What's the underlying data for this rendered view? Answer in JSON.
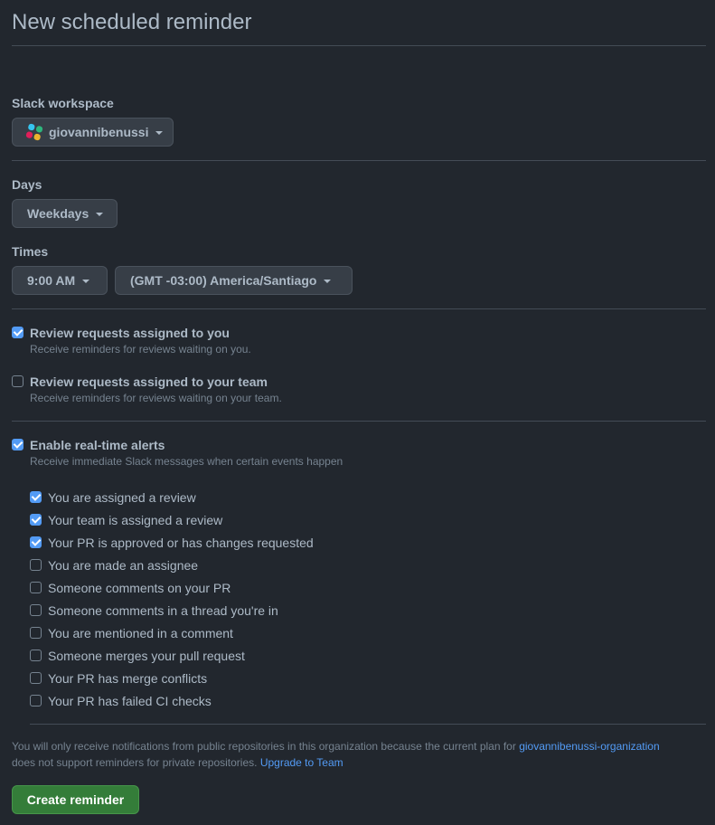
{
  "page": {
    "title": "New scheduled reminder"
  },
  "workspace": {
    "label": "Slack workspace",
    "value": "giovannibenussi",
    "icon": "slack-icon"
  },
  "days": {
    "label": "Days",
    "value": "Weekdays"
  },
  "times": {
    "label": "Times",
    "time_value": "9:00 AM",
    "timezone_value": "(GMT -03:00) America/Santiago"
  },
  "review_options": [
    {
      "title": "Review requests assigned to you",
      "description": "Receive reminders for reviews waiting on you.",
      "checked": true
    },
    {
      "title": "Review requests assigned to your team",
      "description": "Receive reminders for reviews waiting on your team.",
      "checked": false
    }
  ],
  "realtime": {
    "title": "Enable real-time alerts",
    "description": "Receive immediate Slack messages when certain events happen",
    "checked": true,
    "events": [
      {
        "label": "You are assigned a review",
        "checked": true
      },
      {
        "label": "Your team is assigned a review",
        "checked": true
      },
      {
        "label": "Your PR is approved or has changes requested",
        "checked": true
      },
      {
        "label": "You are made an assignee",
        "checked": false
      },
      {
        "label": "Someone comments on your PR",
        "checked": false
      },
      {
        "label": "Someone comments in a thread you're in",
        "checked": false
      },
      {
        "label": "You are mentioned in a comment",
        "checked": false
      },
      {
        "label": "Someone merges your pull request",
        "checked": false
      },
      {
        "label": "Your PR has merge conflicts",
        "checked": false
      },
      {
        "label": "Your PR has failed CI checks",
        "checked": false
      }
    ]
  },
  "footer": {
    "note_before": "You will only receive notifications from public repositories in this organization because the current plan for ",
    "org_link": "giovannibenussi-organization",
    "note_middle": " does not support reminders for private repositories. ",
    "upgrade_link": "Upgrade to Team",
    "create_label": "Create reminder"
  },
  "colors": {
    "background": "#22272e",
    "accent": "#539bf5",
    "primary_button": "#347d39",
    "text": "#adbac7",
    "muted": "#768390"
  }
}
